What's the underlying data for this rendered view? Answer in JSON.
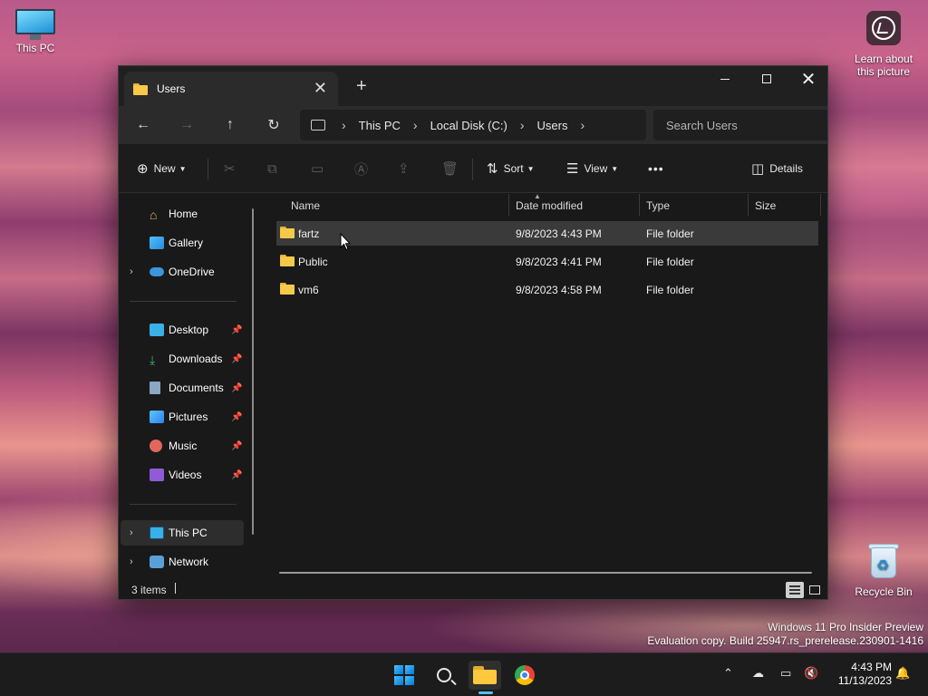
{
  "desktop": {
    "this_pc_label": "This PC",
    "learn_label_1": "Learn about",
    "learn_label_2": "this picture",
    "recycle_label": "Recycle Bin",
    "watermark_line1": "Windows 11 Pro Insider Preview",
    "watermark_line2": "Evaluation copy. Build 25947.rs_prerelease.230901-1416"
  },
  "window": {
    "tab_title": "Users",
    "tab_close": "✕",
    "new_tab": "+",
    "controls": {
      "minimize": "",
      "maximize": "",
      "close": "✕"
    }
  },
  "address": {
    "crumbs": [
      "This PC",
      "Local Disk (C:)",
      "Users"
    ],
    "search_placeholder": "Search Users"
  },
  "commands": {
    "new": "New",
    "sort": "Sort",
    "view": "View",
    "more": "•••",
    "details": "Details"
  },
  "nav": {
    "items": [
      {
        "label": "Home",
        "icon": "home-icon"
      },
      {
        "label": "Gallery",
        "icon": "gallery-icon"
      },
      {
        "label": "OneDrive",
        "icon": "cloud-icon"
      },
      {
        "label": "Desktop",
        "icon": "desktop-icon"
      },
      {
        "label": "Downloads",
        "icon": "download-icon"
      },
      {
        "label": "Documents",
        "icon": "document-icon"
      },
      {
        "label": "Pictures",
        "icon": "pictures-icon"
      },
      {
        "label": "Music",
        "icon": "music-icon"
      },
      {
        "label": "Videos",
        "icon": "videos-icon"
      },
      {
        "label": "This PC",
        "icon": "computer-icon"
      },
      {
        "label": "Network",
        "icon": "network-icon"
      }
    ]
  },
  "list": {
    "columns": [
      "Name",
      "Date modified",
      "Type",
      "Size"
    ],
    "rows": [
      {
        "name": "fartz",
        "date": "9/8/2023 4:43 PM",
        "type": "File folder"
      },
      {
        "name": "Public",
        "date": "9/8/2023 4:41 PM",
        "type": "File folder"
      },
      {
        "name": "vm6",
        "date": "9/8/2023 4:58 PM",
        "type": "File folder"
      }
    ]
  },
  "status": {
    "count": "3 items"
  },
  "taskbar": {
    "time": "4:43 PM",
    "date": "11/13/2023"
  },
  "colors": {
    "accent": "#4cc2ff",
    "folder": "#f7c948"
  }
}
